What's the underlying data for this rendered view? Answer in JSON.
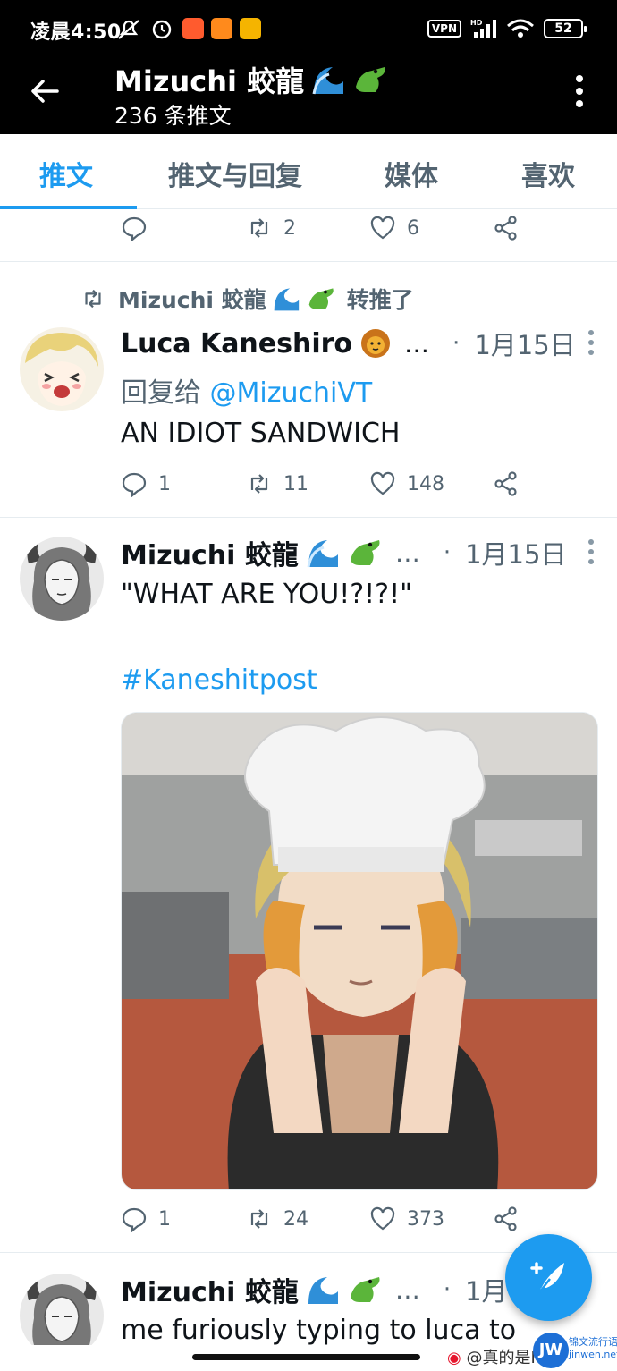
{
  "status_bar": {
    "time": "凌晨4:50",
    "vpn": "VPN",
    "network": "HD",
    "wifi_sub": "6",
    "battery": "52"
  },
  "header": {
    "title": "Mizuchi 蛟龍",
    "subtitle": "236 条推文"
  },
  "tabs": [
    {
      "label": "推文",
      "active": true
    },
    {
      "label": "推文与回复",
      "active": false
    },
    {
      "label": "媒体",
      "active": false
    },
    {
      "label": "喜欢",
      "active": false
    }
  ],
  "tweets": [
    {
      "replies": "",
      "retweets": "2",
      "likes": "6"
    },
    {
      "retweeted_by": "Mizuchi 蛟龍",
      "retweeted_label": "转推了",
      "author": "Luca Kaneshiro",
      "ellipsis": "…",
      "date": "1月15日",
      "reply_prefix": "回复给",
      "reply_to": "@MizuchiVT",
      "text": "AN IDIOT SANDWICH",
      "replies": "1",
      "retweets": "11",
      "likes": "148"
    },
    {
      "author": "Mizuchi 蛟龍",
      "ellipsis": "…",
      "date": "1月15日",
      "text": "\"WHAT ARE YOU!?!?!\"",
      "hashtag": "#Kaneshitpost",
      "replies": "1",
      "retweets": "24",
      "likes": "373"
    },
    {
      "author": "Mizuchi 蛟龍",
      "ellipsis": "…",
      "date": "1月",
      "text": "me furiously typing to luca to"
    }
  ],
  "watermark": {
    "text": "@真的是I",
    "site_top": "锦文流行语",
    "site_bottom": "jinwen.net",
    "logo": "JW"
  },
  "colors": {
    "accent": "#1d9bf0",
    "secondary_text": "#536471",
    "header_bg": "#000000"
  }
}
